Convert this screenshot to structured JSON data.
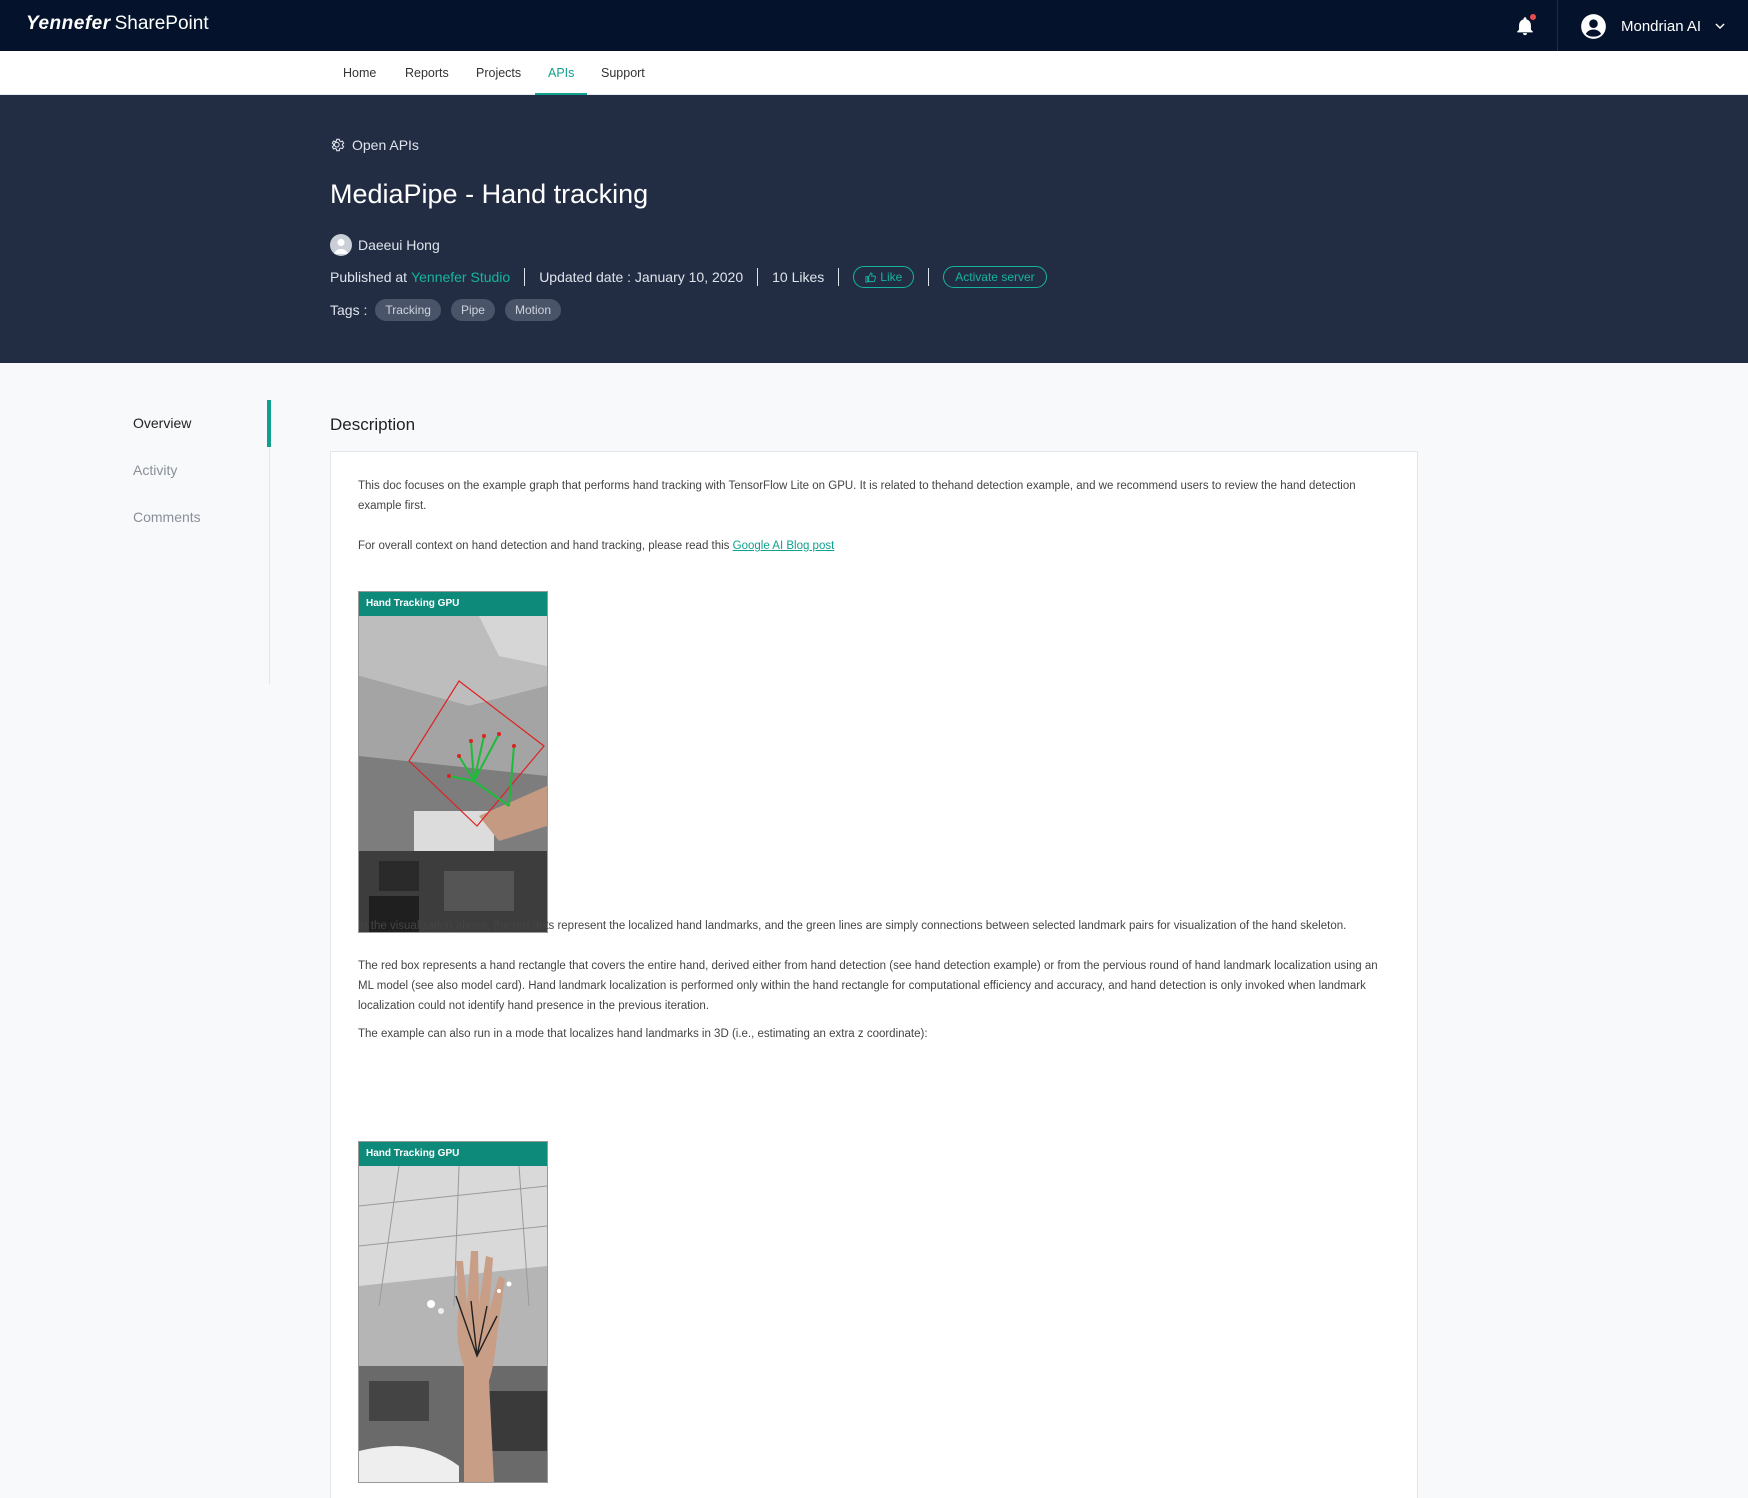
{
  "app": {
    "brand_logo": "Yennefer",
    "brand_suite": "SharePoint",
    "user_name": "Mondrian AI"
  },
  "nav": {
    "items": [
      {
        "label": "Home"
      },
      {
        "label": "Reports"
      },
      {
        "label": "Projects"
      },
      {
        "label": "APIs",
        "active": true
      },
      {
        "label": "Support"
      }
    ]
  },
  "hero": {
    "breadcrumb": "Open APIs",
    "title": "MediaPipe - Hand tracking",
    "author": "Daeeui Hong",
    "published_prefix": "Published at",
    "studio": "Yennefer Studio",
    "updated": "Updated date : January 10, 2020",
    "likes": "10 Likes",
    "like_button": "Like",
    "activate_button": "Activate server",
    "tags_label": "Tags :",
    "tags": [
      "Tracking",
      "Pipe",
      "Motion"
    ]
  },
  "side_tabs": {
    "items": [
      {
        "label": "Overview",
        "active": true
      },
      {
        "label": "Activity"
      },
      {
        "label": "Comments"
      }
    ]
  },
  "content": {
    "section_title": "Description",
    "p1": "This doc focuses on the example graph that performs hand tracking with TensorFlow Lite on GPU. It is related to thehand detection example, and we recommend users to review the hand detection example first.",
    "p2_prefix": "For overall context on hand detection and hand tracking, please read this ",
    "p2_link": "Google AI Blog post",
    "image1_caption": "Hand Tracking GPU",
    "p3": "In the visualization above, the red dots represent the localized hand landmarks, and the green lines are simply connections between selected landmark pairs for visualization of the hand skeleton.",
    "p4": "The red box represents a hand rectangle that covers the entire hand, derived either from hand detection (see hand detection example) or from the pervious round of hand landmark localization using an ML model (see also model card). Hand landmark localization is performed only within the hand rectangle for computational efficiency and accuracy, and hand detection is only invoked when landmark localization could not identify hand presence in the previous iteration.",
    "p5": "The example can also run in a mode that localizes hand landmarks in 3D (i.e., estimating an extra z coordinate):",
    "image2_caption": "Hand Tracking GPU"
  },
  "colors": {
    "topbar": "#04132b",
    "hero": "#222d44",
    "accent": "#11a08d",
    "notification_dot": "#e84c4c"
  },
  "icons": {
    "notification": "bell-icon",
    "account": "user-circle-icon",
    "dropdown": "chevron-down-icon",
    "breadcrumb": "gear-icon",
    "author": "avatar-icon",
    "like": "thumbs-up-icon"
  }
}
